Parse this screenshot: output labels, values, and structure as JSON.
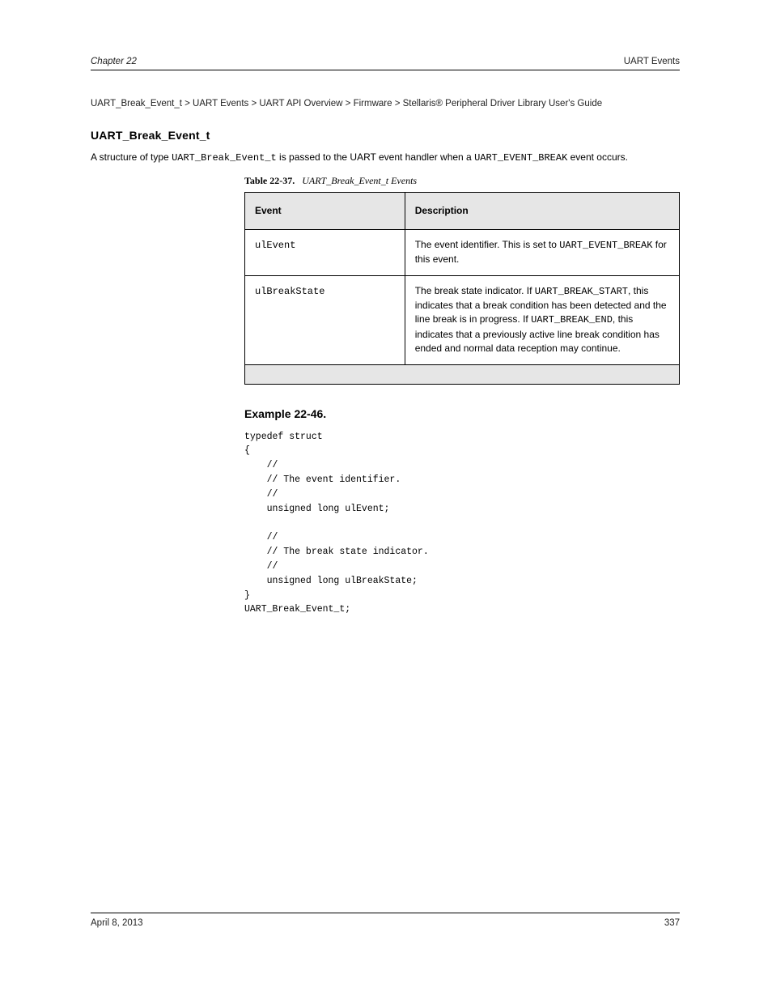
{
  "header": {
    "chapter": "Chapter 22",
    "title": "UART Events"
  },
  "breadcrumb": "UART_Break_Event_t  >  UART Events  >  UART API Overview  >  Firmware  >  Stellaris® Peripheral Driver Library User's\nGuide",
  "section": {
    "title": "UART_Break_Event_t",
    "intro_html": "A structure of type <span class=\"code\">UART_Break_Event_t</span> is passed to the UART event handler when a <span class=\"code\">UART_EVENT_BREAK</span> event occurs."
  },
  "table": {
    "caption_label": "Table 22-37.",
    "caption_title": "UART_Break_Event_t Events",
    "header": {
      "event": "Event",
      "description": "Description"
    },
    "rows": [
      {
        "event": "<span class=\"code\">ulEvent</span>",
        "description": "The event identifier. This is set to <span class=\"code\">UART_EVENT_BREAK</span> for this event."
      },
      {
        "event": "<span class=\"code\">ulBreakState</span>",
        "description": "The break state indicator. If <span class=\"code\">UART_BREAK_START</span>, this indicates that a break condition has been detected and the line break is in progress. If <span class=\"code\">UART_BREAK_END</span>, this indicates that a previously active line break condition has ended and normal data reception may continue."
      }
    ]
  },
  "example": {
    "title": "Example 22-46.",
    "code": "typedef struct\n{\n    //\n    // The event identifier.\n    //\n    unsigned long ulEvent;\n\n    //\n    // The break state indicator.\n    //\n    unsigned long ulBreakState;\n}\nUART_Break_Event_t;"
  },
  "footer": {
    "date": "April 8, 2013",
    "page": "337"
  }
}
